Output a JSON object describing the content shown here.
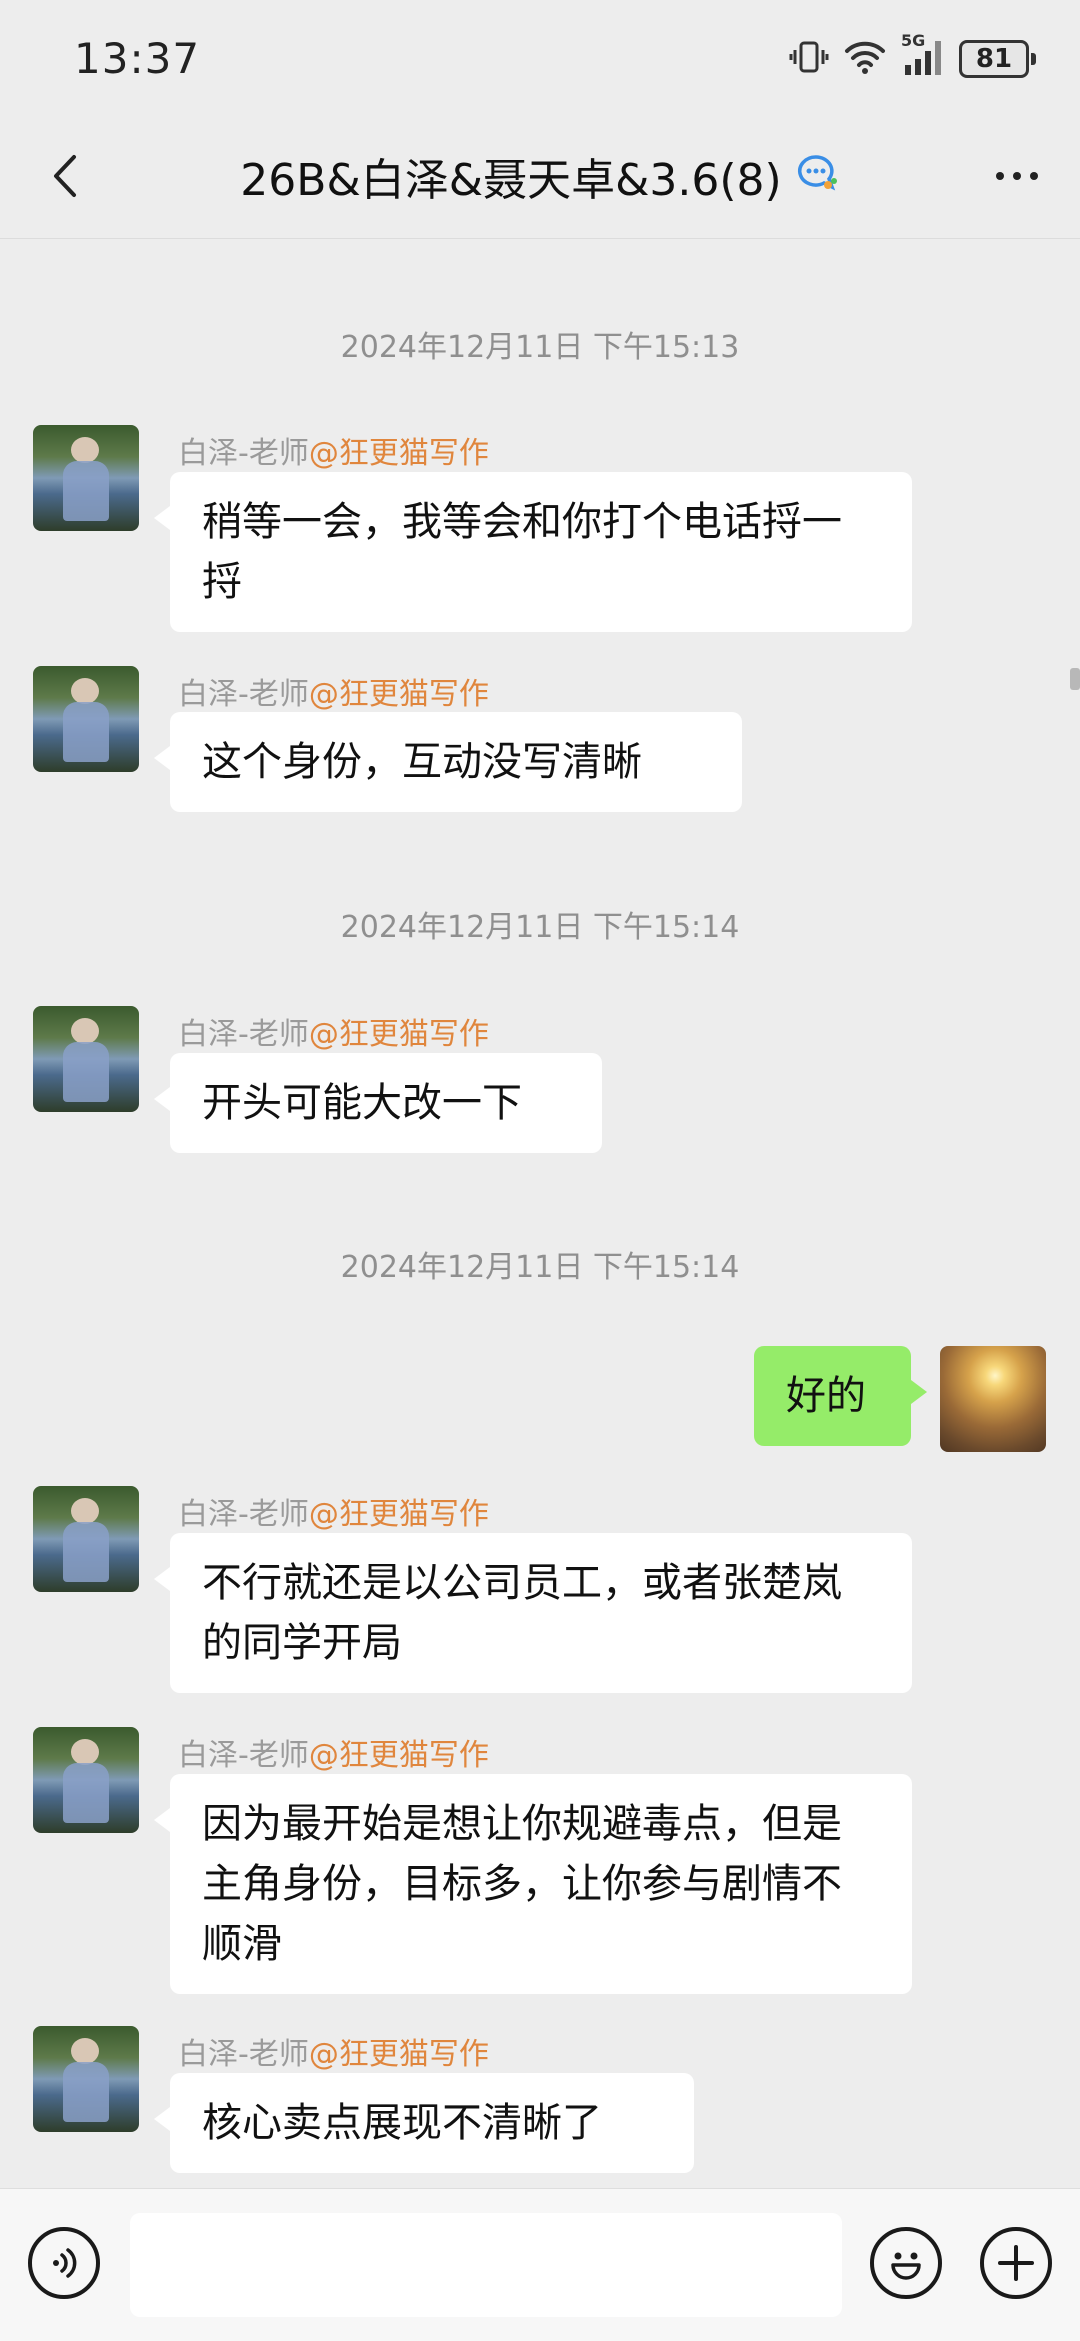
{
  "status_bar": {
    "time": "13:37",
    "network": "5G",
    "battery": "81",
    "icons": [
      "vibrate-icon",
      "wifi-icon",
      "signal-icon",
      "battery-icon"
    ]
  },
  "header": {
    "title": "26B&白泽&聂天卓&3.6(8)",
    "icons": [
      "back-icon",
      "group-chat-icon",
      "more-icon"
    ]
  },
  "messages": {
    "ts1": "2024年12月11日 下午15:13",
    "ts2": "2024年12月11日 下午15:14",
    "ts3": "2024年12月11日 下午15:14",
    "sender_name": "白泽-老师",
    "sender_mention": "@狂更猫写作",
    "m1": "稍等一会，我等会和你打个电话捋一捋",
    "m2": "这个身份，互动没写清晰",
    "m3": "开头可能大改一下",
    "m4": "好的",
    "m5": "不行就还是以公司员工，或者张楚岚的同学开局",
    "m6": "因为最开始是想让你规避毒点，但是主角身份，目标多，让你参与剧情不顺滑",
    "m7": "核心卖点展现不清晰了"
  },
  "input_bar": {
    "value": "",
    "icons": [
      "voice-icon",
      "emoji-icon",
      "plus-icon"
    ]
  },
  "colors": {
    "background": "#ededed",
    "mention": "#e0863d",
    "outgoing_bubble": "#95ec69",
    "incoming_bubble": "#ffffff"
  }
}
